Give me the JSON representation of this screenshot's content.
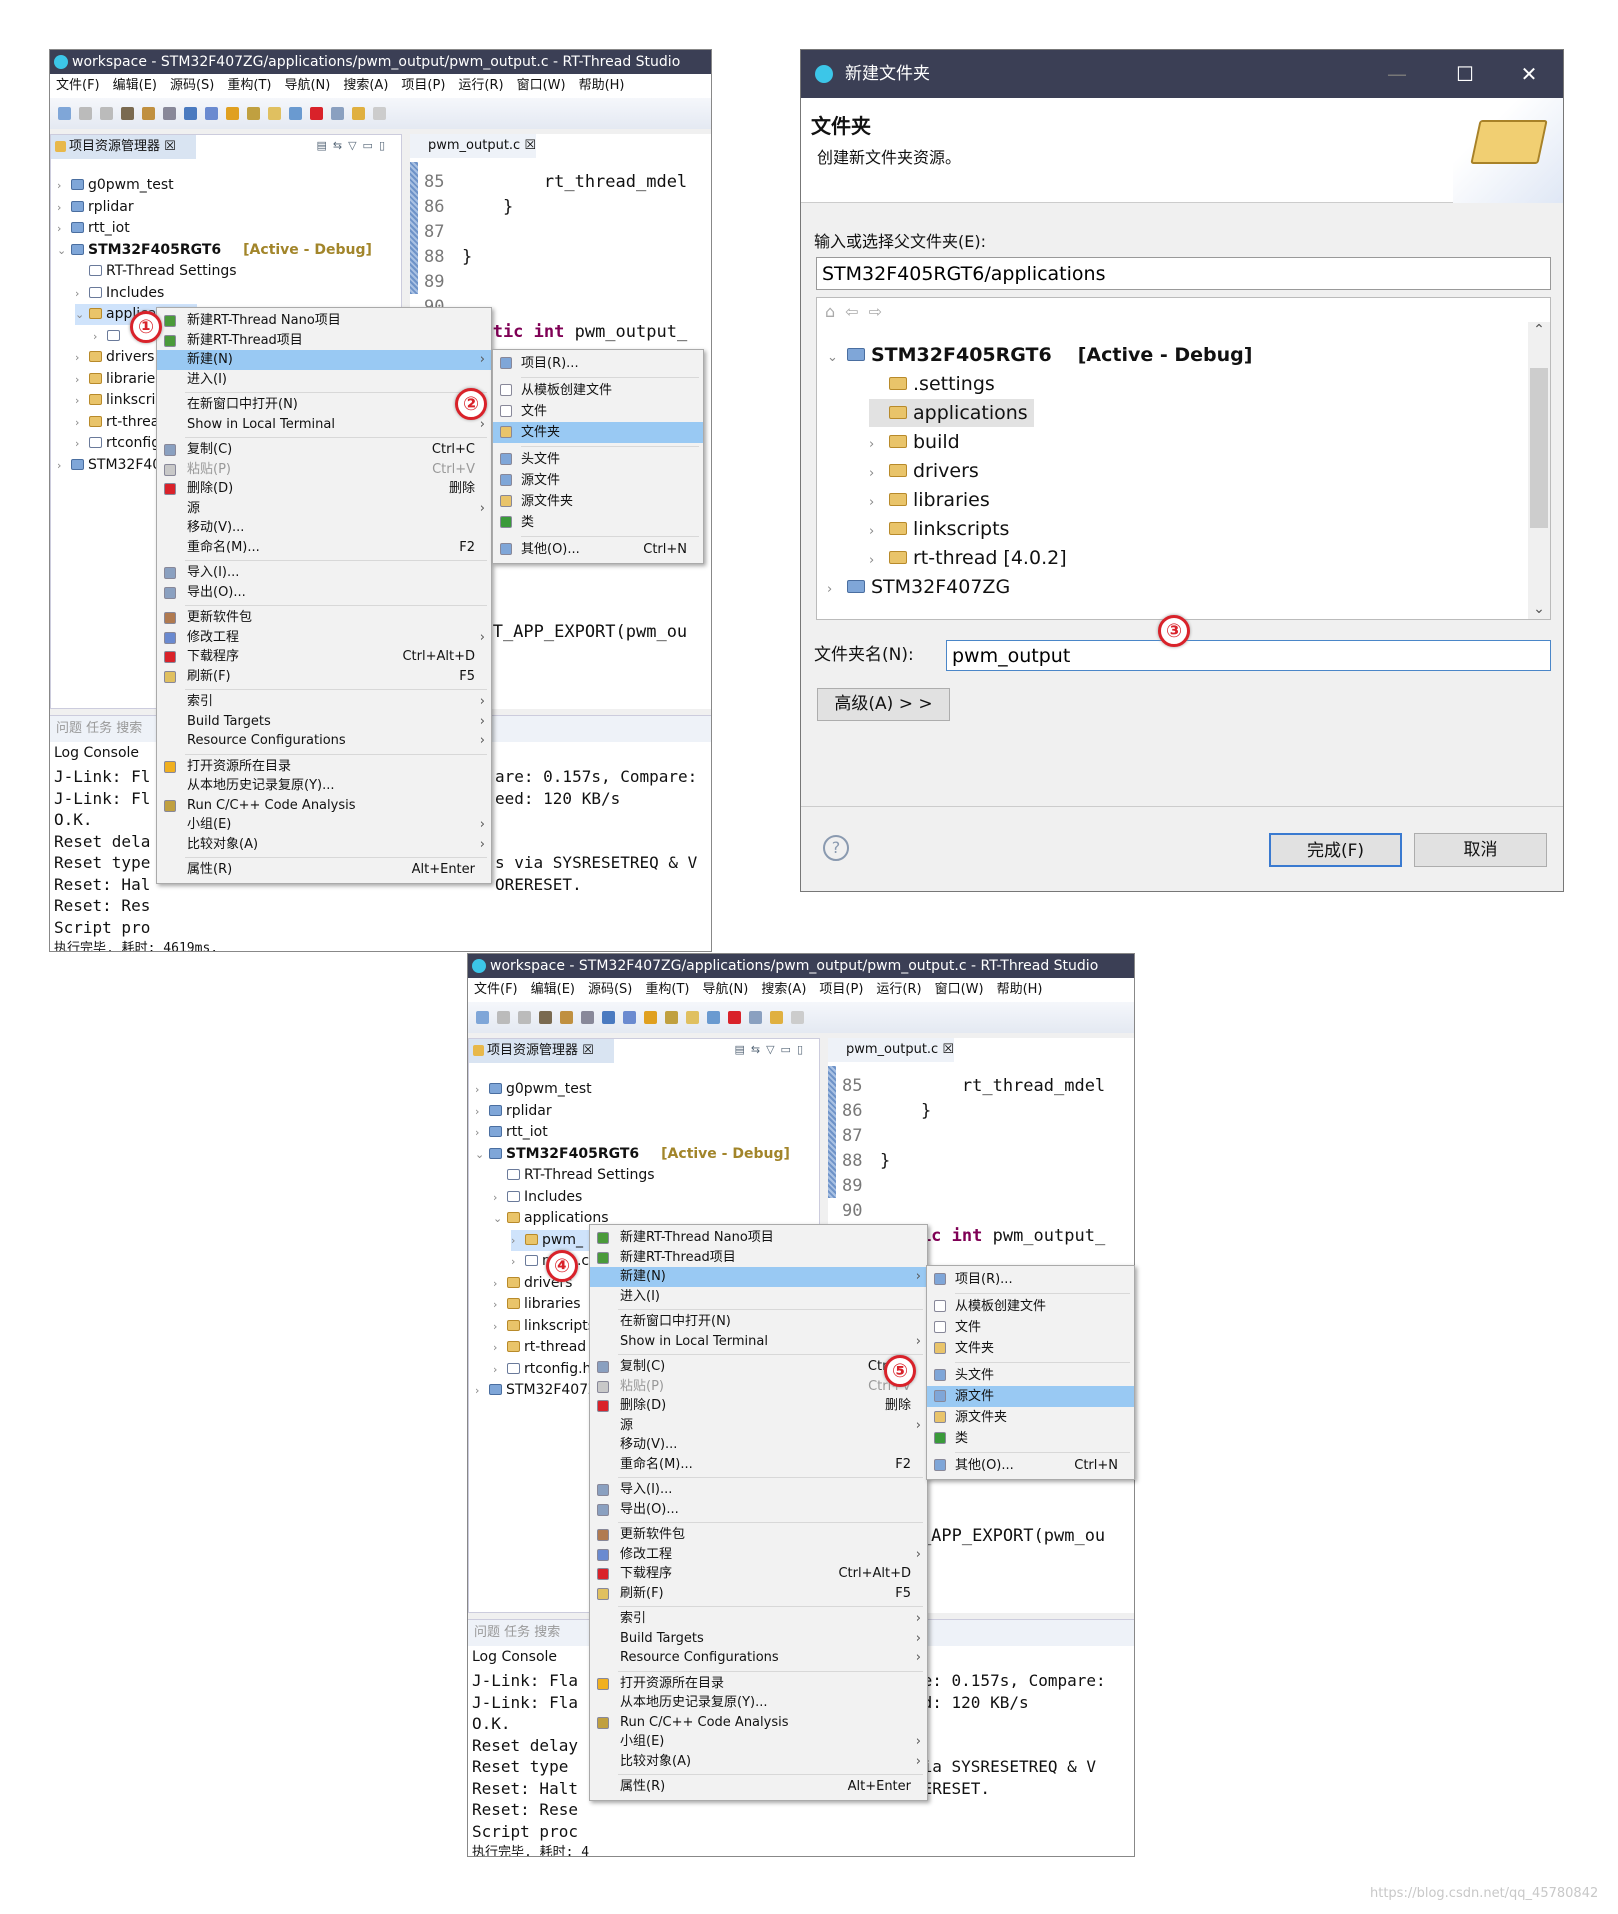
{
  "colors": {
    "titlebar": "#3b3f55",
    "highlight": "#99c9f3",
    "selection": "#cfe3fb",
    "marker": "#d9222a",
    "active_debug": "#a2852a"
  },
  "window_top": {
    "title": "workspace - STM32F407ZG/applications/pwm_output/pwm_output.c - RT-Thread Studio",
    "menubar": [
      "文件(F)",
      "编辑(E)",
      "源码(S)",
      "重构(T)",
      "导航(N)",
      "搜索(A)",
      "项目(P)",
      "运行(R)",
      "窗口(W)",
      "帮助(H)"
    ],
    "explorer_tab": "项目资源管理器 ☒",
    "editor_tab": "pwm_output.c ☒",
    "tree": [
      {
        "label": "g0pwm_test",
        "depth": 0,
        "arrow": "›",
        "icon": "proj"
      },
      {
        "label": "rplidar",
        "depth": 0,
        "arrow": "›",
        "icon": "proj"
      },
      {
        "label": "rtt_iot",
        "depth": 0,
        "arrow": "›",
        "icon": "proj"
      },
      {
        "label": "STM32F405RGT6",
        "depth": 0,
        "arrow": "⌄",
        "icon": "proj",
        "bold": true,
        "badge": "[Active - Debug]"
      },
      {
        "label": "RT-Thread Settings",
        "depth": 1,
        "arrow": "",
        "icon": "rt"
      },
      {
        "label": "Includes",
        "depth": 1,
        "arrow": "›",
        "icon": "file"
      },
      {
        "label": "applications",
        "depth": 1,
        "arrow": "⌄",
        "icon": "fold",
        "selected": true
      },
      {
        "label": "",
        "depth": 2,
        "arrow": "›",
        "icon": "file"
      },
      {
        "label": "drivers",
        "depth": 1,
        "arrow": "›",
        "icon": "fold"
      },
      {
        "label": "libraries",
        "depth": 1,
        "arrow": "›",
        "icon": "fold"
      },
      {
        "label": "linkscripts",
        "depth": 1,
        "arrow": "›",
        "icon": "fold"
      },
      {
        "label": "rt-thread",
        "depth": 1,
        "arrow": "›",
        "icon": "fold"
      },
      {
        "label": "rtconfig.h",
        "depth": 1,
        "arrow": "›",
        "icon": "file"
      },
      {
        "label": "STM32F407ZG",
        "depth": 0,
        "arrow": "›",
        "icon": "proj"
      }
    ],
    "code": [
      {
        "ln": "85",
        "text": "        rt_thread_mdel"
      },
      {
        "ln": "86",
        "text": "    }"
      },
      {
        "ln": "87",
        "text": ""
      },
      {
        "ln": "88",
        "text": "}"
      },
      {
        "ln": "89",
        "text": ""
      },
      {
        "ln": "90",
        "text": ""
      },
      {
        "ln": "91",
        "text": "static int pwm_output_",
        "kw": true
      }
    ],
    "code_far": "INIT_APP_EXPORT(pwm_ou",
    "console_tabs": "问题  任务                                              搜索",
    "console_label": "Log Console",
    "console_left": [
      "J-Link: Fl",
      "J-Link: Fl",
      "O.K.",
      "Reset dela",
      "Reset type",
      "Reset: Hal",
      "Reset: Res",
      "Script pro"
    ],
    "console_right": [
      "are: 0.157s, Compare:",
      "eed: 120 KB/s",
      "",
      "",
      "s via SYSRESETREQ & V",
      "ORERESET.",
      "",
      ""
    ],
    "console_last": "执行完毕, 耗时: 4619ms."
  },
  "window_bottom": {
    "title": "workspace - STM32F407ZG/applications/pwm_output/pwm_output.c - RT-Thread Studio",
    "tree": [
      {
        "label": "g0pwm_test",
        "depth": 0,
        "arrow": "›",
        "icon": "proj"
      },
      {
        "label": "rplidar",
        "depth": 0,
        "arrow": "›",
        "icon": "proj"
      },
      {
        "label": "rtt_iot",
        "depth": 0,
        "arrow": "›",
        "icon": "proj"
      },
      {
        "label": "STM32F405RGT6",
        "depth": 0,
        "arrow": "⌄",
        "icon": "proj",
        "bold": true,
        "badge": "[Active - Debug]"
      },
      {
        "label": "RT-Thread Settings",
        "depth": 1,
        "arrow": "",
        "icon": "rt"
      },
      {
        "label": "Includes",
        "depth": 1,
        "arrow": "›",
        "icon": "file"
      },
      {
        "label": "applications",
        "depth": 1,
        "arrow": "⌄",
        "icon": "fold"
      },
      {
        "label": "pwm_",
        "depth": 2,
        "arrow": "›",
        "icon": "fold",
        "selected": true
      },
      {
        "label": "main.c",
        "depth": 2,
        "arrow": "›",
        "icon": "file"
      },
      {
        "label": "drivers",
        "depth": 1,
        "arrow": "›",
        "icon": "fold"
      },
      {
        "label": "libraries",
        "depth": 1,
        "arrow": "›",
        "icon": "fold"
      },
      {
        "label": "linkscripts",
        "depth": 1,
        "arrow": "›",
        "icon": "fold"
      },
      {
        "label": "rt-thread",
        "depth": 1,
        "arrow": "›",
        "icon": "fold"
      },
      {
        "label": "rtconfig.h",
        "depth": 1,
        "arrow": "›",
        "icon": "file"
      },
      {
        "label": "STM32F407ZG",
        "depth": 0,
        "arrow": "›",
        "icon": "proj"
      }
    ],
    "console_left": [
      "J-Link: Fla",
      "J-Link: Fla",
      "O.K.",
      "Reset delay",
      "Reset type",
      "Reset: Halt",
      "Reset: Rese",
      "Script proc"
    ],
    "console_right": [
      "re: 0.157s, Compare:",
      "ed: 120 KB/s",
      "",
      "",
      "via SYSRESETREQ & V",
      "RERESET.",
      "",
      ""
    ],
    "console_last": "执行完毕, 耗时: 4"
  },
  "context_menu": [
    {
      "label": "新建RT-Thread Nano项目",
      "icon": "#4a9a3a"
    },
    {
      "label": "新建RT-Thread项目",
      "icon": "#4a9a3a"
    },
    {
      "label": "新建(N)",
      "sub": true,
      "hl": true
    },
    {
      "label": "进入(I)"
    },
    {
      "sep": true
    },
    {
      "label": "在新窗口中打开(N)"
    },
    {
      "label": "Show in Local Terminal",
      "sub": true
    },
    {
      "sep": true
    },
    {
      "label": "复制(C)",
      "sc": "Ctrl+C",
      "icon": "#8aa0c0"
    },
    {
      "label": "粘贴(P)",
      "sc": "Ctrl+V",
      "dis": true,
      "icon": "#c8c8c8"
    },
    {
      "label": "删除(D)",
      "sc": "删除",
      "icon": "#d9222a"
    },
    {
      "label": "源",
      "sub": true
    },
    {
      "label": "移动(V)..."
    },
    {
      "label": "重命名(M)...",
      "sc": "F2"
    },
    {
      "sep": true
    },
    {
      "label": "导入(I)...",
      "icon": "#8aa0c0"
    },
    {
      "label": "导出(O)...",
      "icon": "#8aa0c0"
    },
    {
      "sep": true
    },
    {
      "label": "更新软件包",
      "icon": "#b07a50"
    },
    {
      "label": "修改工程",
      "sub": true,
      "icon": "#6a8ad0"
    },
    {
      "label": "下载程序",
      "sc": "Ctrl+Alt+D",
      "icon": "#d9222a"
    },
    {
      "label": "刷新(F)",
      "sc": "F5",
      "icon": "#e0c060"
    },
    {
      "sep": true
    },
    {
      "label": "索引",
      "sub": true
    },
    {
      "label": "Build Targets",
      "sub": true
    },
    {
      "label": "Resource Configurations",
      "sub": true
    },
    {
      "sep": true
    },
    {
      "label": "打开资源所在目录",
      "icon": "#f0b020"
    },
    {
      "label": "从本地历史记录复原(Y)..."
    },
    {
      "label": "Run C/C++ Code Analysis",
      "icon": "#c0a040"
    },
    {
      "label": "小组(E)",
      "sub": true
    },
    {
      "label": "比较对象(A)",
      "sub": true
    },
    {
      "sep": true
    },
    {
      "label": "属性(R)",
      "sc": "Alt+Enter"
    }
  ],
  "submenu": [
    {
      "label": "项目(R)...",
      "icon": "#7fa6d8"
    },
    {
      "sep": true
    },
    {
      "label": "从模板创建文件",
      "icon": "#ffffff"
    },
    {
      "label": "文件",
      "icon": "#ffffff"
    },
    {
      "label": "文件夹",
      "icon": "#e9c46a",
      "id": "folder"
    },
    {
      "sep": true
    },
    {
      "label": "头文件",
      "icon": "#7fa6d8"
    },
    {
      "label": "源文件",
      "icon": "#7fa6d8",
      "id": "source"
    },
    {
      "label": "源文件夹",
      "icon": "#e9c46a"
    },
    {
      "label": "类",
      "icon": "#3a9a3a"
    },
    {
      "sep": true
    },
    {
      "label": "其他(O)...",
      "sc": "Ctrl+N",
      "icon": "#7fa6d8"
    }
  ],
  "markers": [
    "①",
    "②",
    "③",
    "④",
    "⑤"
  ],
  "dialog": {
    "title": "新建文件夹",
    "heading": "文件夹",
    "description": "创建新文件夹资源。",
    "parent_label": "输入或选择父文件夹(E):",
    "parent_value": "STM32F405RGT6/applications",
    "tree": [
      {
        "label": "STM32F405RGT6",
        "arrow": "⌄",
        "depth": 0,
        "bold": true,
        "badge": "[Active - Debug]",
        "icon": "proj"
      },
      {
        "label": ".settings",
        "arrow": "",
        "depth": 1,
        "icon": "fold"
      },
      {
        "label": "applications",
        "arrow": "",
        "depth": 1,
        "icon": "fold",
        "selected": true
      },
      {
        "label": "build",
        "arrow": "›",
        "depth": 1,
        "icon": "fold"
      },
      {
        "label": "drivers",
        "arrow": "›",
        "depth": 1,
        "icon": "fold"
      },
      {
        "label": "libraries",
        "arrow": "›",
        "depth": 1,
        "icon": "fold"
      },
      {
        "label": "linkscripts",
        "arrow": "›",
        "depth": 1,
        "icon": "fold"
      },
      {
        "label": "rt-thread [4.0.2]",
        "arrow": "›",
        "depth": 1,
        "icon": "fold"
      },
      {
        "label": "STM32F407ZG",
        "arrow": "›",
        "depth": 0,
        "icon": "proj"
      }
    ],
    "name_label": "文件夹名(N):",
    "name_value": "pwm_output",
    "advanced": "高级(A) > >",
    "finish": "完成(F)",
    "cancel": "取消",
    "help": "?"
  },
  "watermark": "https://blog.csdn.net/qq_45780842"
}
